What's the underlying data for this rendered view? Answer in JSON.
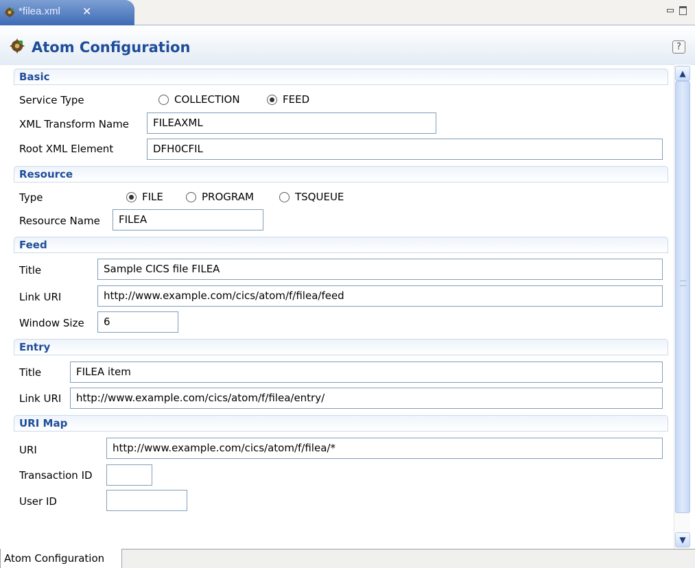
{
  "editor_tab": {
    "title": "*filea.xml",
    "close": "✕"
  },
  "form": {
    "title": "Atom Configuration",
    "help": "?"
  },
  "basic": {
    "title": "Basic",
    "service_type_label": "Service Type",
    "service_types": [
      {
        "label": "COLLECTION",
        "selected": false
      },
      {
        "label": "FEED",
        "selected": true
      }
    ],
    "xml_transform_label": "XML Transform Name",
    "xml_transform_value": "FILEAXML",
    "root_element_label": "Root XML Element",
    "root_element_value": "DFH0CFIL"
  },
  "resource": {
    "title": "Resource",
    "type_label": "Type",
    "types": [
      {
        "label": "FILE",
        "selected": true
      },
      {
        "label": "PROGRAM",
        "selected": false
      },
      {
        "label": "TSQUEUE",
        "selected": false
      }
    ],
    "name_label": "Resource Name",
    "name_value": "FILEA"
  },
  "feed": {
    "title": "Feed",
    "title_label": "Title",
    "title_value": "Sample CICS file FILEA",
    "link_label": "Link URI",
    "link_value": "http://www.example.com/cics/atom/f/filea/feed",
    "window_label": "Window Size",
    "window_value": "6"
  },
  "entry": {
    "title": "Entry",
    "title_label": "Title",
    "title_value": "FILEA item",
    "link_label": "Link URI",
    "link_value": "http://www.example.com/cics/atom/f/filea/entry/"
  },
  "urimap": {
    "title": "URI Map",
    "uri_label": "URI",
    "uri_value": "http://www.example.com/cics/atom/f/filea/*",
    "tran_label": "Transaction ID",
    "tran_value": "",
    "user_label": "User ID",
    "user_value": ""
  },
  "bottom_tabs": [
    "Atom Configuration"
  ],
  "colors": {
    "section_title": "#1f4d9a",
    "tab_active": "#3e6bb5"
  }
}
